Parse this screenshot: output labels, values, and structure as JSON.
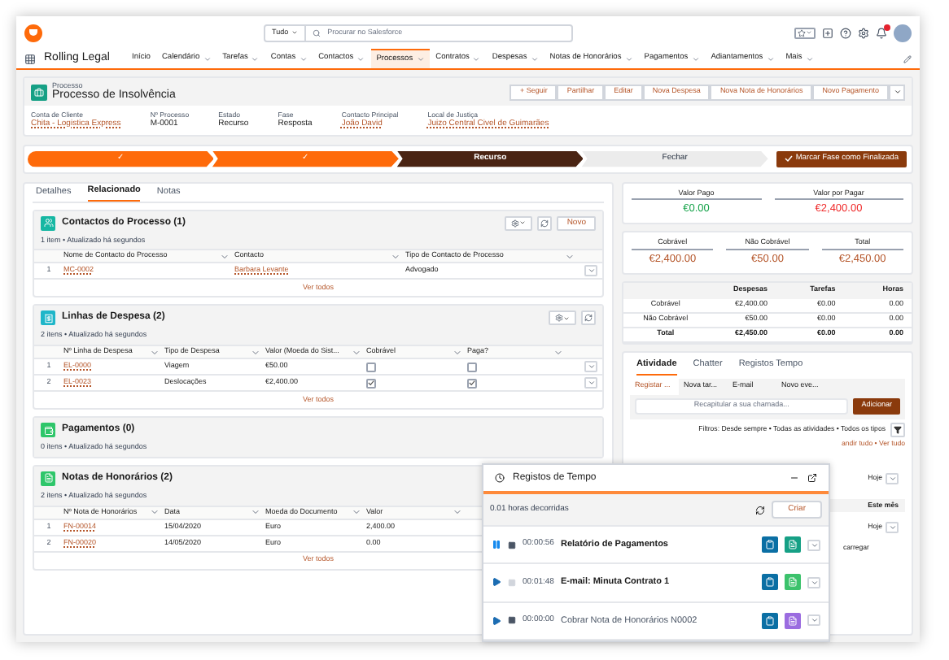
{
  "header": {
    "search_scope": "Tudo",
    "search_placeholder": "Procurar no Salesforce"
  },
  "nav": {
    "app_name": "Rolling Legal",
    "items": [
      {
        "label": "Início",
        "selected": false,
        "has_menu": false
      },
      {
        "label": "Calendário",
        "selected": false,
        "has_menu": true
      },
      {
        "label": "Tarefas",
        "selected": false,
        "has_menu": true
      },
      {
        "label": "Contas",
        "selected": false,
        "has_menu": true
      },
      {
        "label": "Contactos",
        "selected": false,
        "has_menu": true
      },
      {
        "label": "Processos",
        "selected": true,
        "has_menu": true
      },
      {
        "label": "Contratos",
        "selected": false,
        "has_menu": true
      },
      {
        "label": "Despesas",
        "selected": false,
        "has_menu": true
      },
      {
        "label": "Notas de Honorários",
        "selected": false,
        "has_menu": true
      },
      {
        "label": "Pagamentos",
        "selected": false,
        "has_menu": true
      },
      {
        "label": "Adiantamentos",
        "selected": false,
        "has_menu": true
      },
      {
        "label": "Mais",
        "selected": false,
        "has_menu": true
      }
    ]
  },
  "record": {
    "object_type": "Processo",
    "title": "Processo de Insolvência",
    "actions": [
      "+ Seguir",
      "Partilhar",
      "Editar",
      "Nova Despesa",
      "Nova Nota de Honorários",
      "Novo Pagamento"
    ],
    "fields": [
      {
        "label": "Conta de Cliente",
        "value": "Chita - Logistica Express",
        "link": true
      },
      {
        "label": "Nº Processo",
        "value": "M-0001",
        "link": false
      },
      {
        "label": "Estado",
        "value": "Recurso",
        "link": false
      },
      {
        "label": "Fase",
        "value": "Resposta",
        "link": false
      },
      {
        "label": "Contacto Principal",
        "value": "João David",
        "link": true
      },
      {
        "label": "Local de Justiça",
        "value": "Juizo Central Civel de Guimarães",
        "link": true
      }
    ]
  },
  "path": {
    "stages": [
      {
        "label": "✓",
        "complete": true,
        "current": false
      },
      {
        "label": "✓",
        "complete": true,
        "current": false
      },
      {
        "label": "Recurso",
        "complete": false,
        "current": true
      },
      {
        "label": "Fechar",
        "complete": false,
        "current": false
      }
    ],
    "button": "Marcar Fase como Finalizada"
  },
  "tabs": [
    {
      "label": "Detalhes",
      "selected": false
    },
    {
      "label": "Relacionado",
      "selected": true
    },
    {
      "label": "Notas",
      "selected": false
    }
  ],
  "related_lists": [
    {
      "title": "Contactos do Processo (1)",
      "subtitle": "1 item • Atualizado há segundos",
      "color": "#16b7a3",
      "new_button": "Novo",
      "columns": [
        "Nome de Contacto do Processo",
        "Contacto",
        "Tipo de Contacto de Processo"
      ],
      "rows": [
        {
          "number": "1",
          "cells": [
            {
              "kind": "link",
              "text": "MC-0002"
            },
            {
              "kind": "link",
              "text": "Barbara Levante"
            },
            {
              "kind": "text",
              "text": "Advogado"
            }
          ]
        }
      ],
      "footer": "Ver todos"
    },
    {
      "title": "Linhas de Despesa (2)",
      "subtitle": "2 itens • Atualizado há segundos",
      "color": "#1fb6c9",
      "columns": [
        "Nº Linha de Despesa",
        "Tipo de Despesa",
        "Valor (Moeda do Sist...",
        "Cobrável",
        "Paga?"
      ],
      "rows": [
        {
          "number": "1",
          "cells": [
            {
              "kind": "link",
              "text": "EL-0000"
            },
            {
              "kind": "text",
              "text": "Viagem"
            },
            {
              "kind": "text",
              "text": "€50.00"
            },
            {
              "kind": "checkbox",
              "checked": false
            },
            {
              "kind": "checkbox",
              "checked": false
            }
          ]
        },
        {
          "number": "2",
          "cells": [
            {
              "kind": "link",
              "text": "EL-0023"
            },
            {
              "kind": "text",
              "text": "Deslocações"
            },
            {
              "kind": "text",
              "text": "€2,400.00"
            },
            {
              "kind": "checkbox",
              "checked": true
            },
            {
              "kind": "checkbox",
              "checked": true
            }
          ]
        }
      ],
      "footer": "Ver todos"
    },
    {
      "title": "Pagamentos (0)",
      "subtitle": "0 itens • Atualizado há segundos",
      "color": "#2ec66a"
    },
    {
      "title": "Notas de Honorários (2)",
      "subtitle": "2 itens • Atualizado há segundos",
      "color": "#2ec66a",
      "columns": [
        "Nº Nota de Honorários",
        "Data",
        "Moeda do Documento",
        "Valor"
      ],
      "rows": [
        {
          "number": "1",
          "cells": [
            {
              "kind": "link",
              "text": "FN-00014"
            },
            {
              "kind": "text",
              "text": "15/04/2020"
            },
            {
              "kind": "text",
              "text": "Euro"
            },
            {
              "kind": "text",
              "text": "2,400.00"
            }
          ]
        },
        {
          "number": "2",
          "cells": [
            {
              "kind": "link",
              "text": "FN-00020"
            },
            {
              "kind": "text",
              "text": "14/05/2020"
            },
            {
              "kind": "text",
              "text": "Euro"
            },
            {
              "kind": "text",
              "text": "0.00"
            }
          ]
        }
      ],
      "footer": "Ver todos"
    }
  ],
  "summary_cards": [
    [
      {
        "label": "Valor Pago",
        "value": "€0.00",
        "color": "#16a34a"
      },
      {
        "label": "Valor por Pagar",
        "value": "€2,400.00",
        "color": "#ef2b2b"
      }
    ],
    [
      {
        "label": "Cobrável",
        "value": "€2,400.00",
        "color": "#b5562a"
      },
      {
        "label": "Não Cobrável",
        "value": "€50.00",
        "color": "#b5562a"
      },
      {
        "label": "Total",
        "value": "€2,450.00",
        "color": "#b5562a"
      }
    ]
  ],
  "totals_table": {
    "columns": [
      "Despesas",
      "Tarefas",
      "Horas"
    ],
    "rows": [
      {
        "label": "Cobrável",
        "values": [
          "€2,400.00",
          "€0.00",
          "0.00"
        ],
        "total": false
      },
      {
        "label": "Não Cobrável",
        "values": [
          "€50.00",
          "€0.00",
          "0.00"
        ],
        "total": false
      },
      {
        "label": "Total",
        "values": [
          "€2,450.00",
          "€0.00",
          "0.00"
        ],
        "total": true
      }
    ]
  },
  "activity": {
    "tabs": [
      {
        "label": "Atividade",
        "selected": true
      },
      {
        "label": "Chatter",
        "selected": false
      },
      {
        "label": "Registos Tempo",
        "selected": false
      }
    ],
    "subtabs": [
      {
        "label": "Registar ...",
        "selected": true
      },
      {
        "label": "Nova tar...",
        "selected": false
      },
      {
        "label": "E-mail",
        "selected": false
      },
      {
        "label": "Novo eve...",
        "selected": false
      }
    ],
    "placeholder": "Recapitular a sua chamada...",
    "add_button": "Adicionar",
    "filters": "Filtros: Desde sempre • Todas as atividades • Todos os tipos",
    "links": "andir tudo • Ver tudo",
    "first_date": "Hoje",
    "section": "Este mês",
    "second_date": "Hoje",
    "load_more": "carregar"
  },
  "timer": {
    "title": "Registos de Tempo",
    "elapsed": "0.01 horas decorridas",
    "create_button": "Criar",
    "entries": [
      {
        "running": true,
        "stop_enabled": true,
        "time": "00:00:56",
        "label": "Relatório de Pagamentos",
        "emphasis": true,
        "color": "#16a085"
      },
      {
        "running": false,
        "stop_enabled": false,
        "time": "00:01:48",
        "label": "E-mail: Minuta Contrato 1",
        "emphasis": true,
        "color": "#3cc26c"
      },
      {
        "running": false,
        "stop_enabled": true,
        "time": "00:00:00",
        "label": "Cobrar Nota de Honorários N0002",
        "emphasis": false,
        "color": "#9b6ce0"
      }
    ]
  }
}
